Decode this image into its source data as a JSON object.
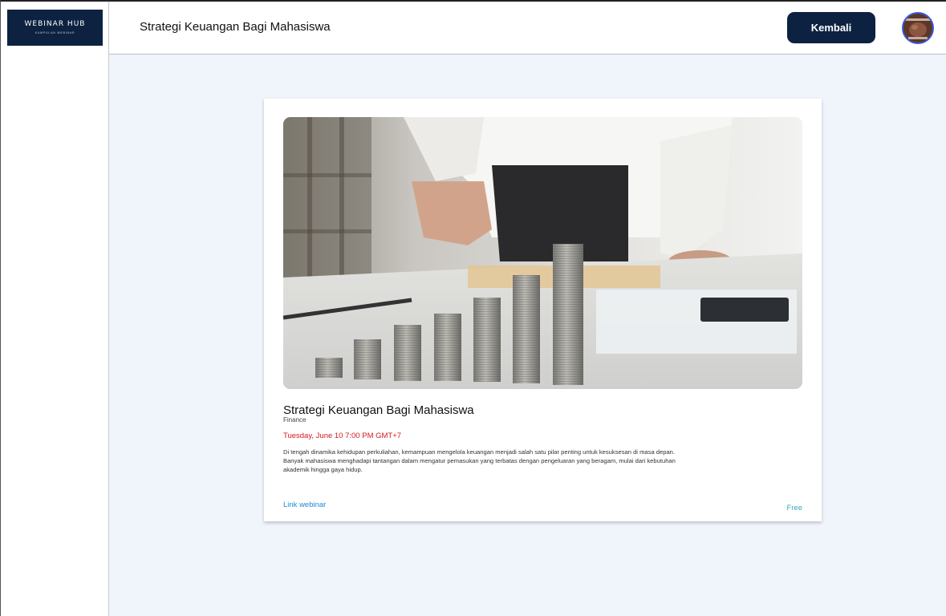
{
  "sidebar": {
    "logo": {
      "title": "WEBINAR HUB",
      "subtitle": "KUMPULAN WEBINAR"
    }
  },
  "header": {
    "title": "Strategi Keuangan Bagi Mahasiswa",
    "back_label": "Kembali",
    "avatar_icon": "user-avatar-icon"
  },
  "webinar": {
    "image_icon": "coin-stacks-photo",
    "title": "Strategi Keuangan Bagi Mahasiswa",
    "category": "Finance",
    "date": "Tuesday, June 10 7:00 PM GMT+7",
    "description": "Di tengah dinamika kehidupan perkuliahan, kemampuan mengelola keuangan menjadi salah satu pilar penting untuk kesuksesan di masa depan. Banyak mahasiswa menghadapi tantangan dalam mengatur pemasukan yang terbatas dengan pengeluaran yang beragam, mulai dari kebutuhan akademik hingga gaya hidup.",
    "link_label": "Link webinar",
    "price": "Free"
  },
  "colors": {
    "brand": "#0c2240",
    "background": "#f0f5fc",
    "date": "#d3181b",
    "link": "#1c8bd6",
    "price": "#3aa6b6"
  }
}
